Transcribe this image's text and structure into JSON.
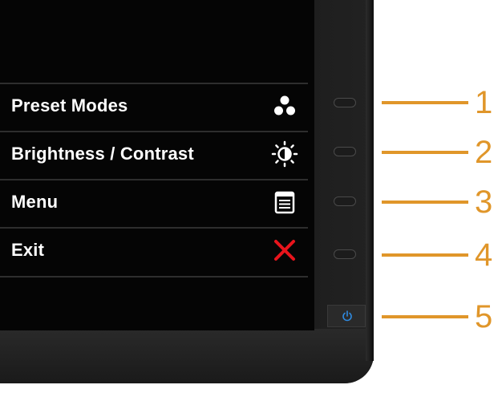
{
  "osd": {
    "items": [
      {
        "label": "Preset Modes",
        "icon": "preset-modes-icon"
      },
      {
        "label": "Brightness / Contrast",
        "icon": "brightness-contrast-icon"
      },
      {
        "label": "Menu",
        "icon": "menu-icon"
      },
      {
        "label": "Exit",
        "icon": "exit-icon"
      }
    ]
  },
  "buttons": {
    "callouts": [
      "1",
      "2",
      "3",
      "4",
      "5"
    ],
    "power_icon": "power-icon"
  },
  "colors": {
    "callout": "#e0962a",
    "exit": "#e8141c",
    "power": "#2f8ae0",
    "osd_text": "#ffffff"
  }
}
